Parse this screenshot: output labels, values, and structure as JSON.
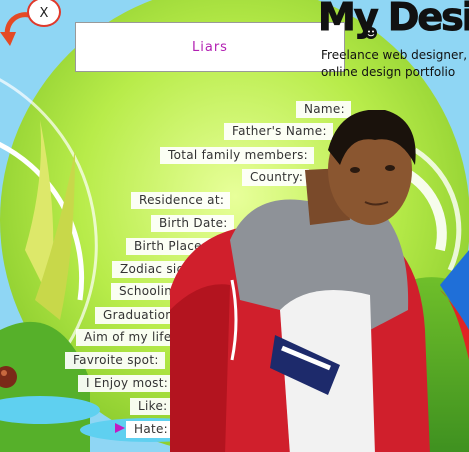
{
  "close_label": "X",
  "title": "Liars",
  "brand": {
    "logo": "My Design",
    "tagline_line1": "Freelance web designer,",
    "tagline_line2": "online design portfolio"
  },
  "fields": [
    "Name:",
    "Father's Name:",
    "Total family members:",
    "Country:",
    "Residence at:",
    "Birth Date:",
    "Birth Place:",
    "Zodiac sign:",
    "Schooling:",
    "Graduation:",
    "Aim of my life:",
    "Favroite spot:",
    "I Enjoy most:",
    "Like:",
    "Hate:"
  ],
  "colors": {
    "title_text": "#b21fb2",
    "arrow": "#c21bc2",
    "close_border": "#e0392b"
  },
  "icons": {
    "close": "close-icon",
    "back": "back-arrow-icon",
    "pointer": "pointer-arrow-icon"
  }
}
